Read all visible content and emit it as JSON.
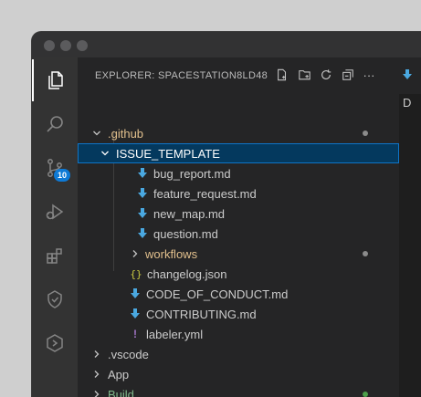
{
  "explorer": {
    "title": "EXPLORER: SPACESTATION8LD48",
    "actions": [
      "new-file-icon",
      "new-folder-icon",
      "refresh-icon",
      "collapse-all-icon",
      "more-icon"
    ],
    "more_label": "···"
  },
  "activity_bar": {
    "items": [
      {
        "name": "explorer",
        "icon": "files-icon",
        "active": true
      },
      {
        "name": "search",
        "icon": "search-icon"
      },
      {
        "name": "source-control",
        "icon": "source-control-icon",
        "badge": "10"
      },
      {
        "name": "run-debug",
        "icon": "run-debug-icon"
      },
      {
        "name": "extensions",
        "icon": "extensions-icon"
      },
      {
        "name": "testing",
        "icon": "testing-icon"
      },
      {
        "name": "remote",
        "icon": "remote-icon"
      }
    ]
  },
  "tree": {
    "github": ".github",
    "issue_template": "ISSUE_TEMPLATE",
    "bug_report": "bug_report.md",
    "feature_request": "feature_request.md",
    "new_map": "new_map.md",
    "question": "question.md",
    "workflows": "workflows",
    "changelog": "changelog.json",
    "changelog_icon": "{}",
    "code_of_conduct": "CODE_OF_CONDUCT.md",
    "contributing": "CONTRIBUTING.md",
    "labeler": "labeler.yml",
    "labeler_icon": "!",
    "vscode": ".vscode",
    "app": "App",
    "build": "Build"
  },
  "editor": {
    "tab_partial_text": "D"
  },
  "colors": {
    "modified_dot": "#8b8b8b",
    "added_dot": "#4d9f4a",
    "folder_modified": "#e2c08d",
    "added_text": "#81b88b",
    "markdown_icon": "#4aa8e0",
    "json_icon": "#cbcb41",
    "yaml_icon": "#a074c4",
    "selection_bg": "#04395e",
    "selection_border": "#0f74c6",
    "badge": "#0e7ad6"
  }
}
